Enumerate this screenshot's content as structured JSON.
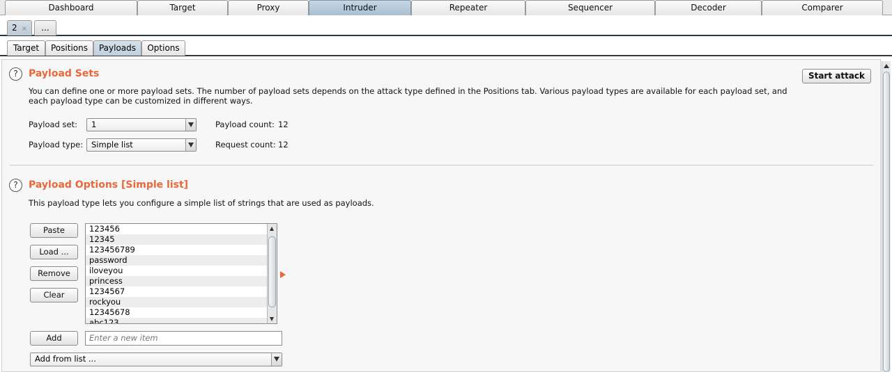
{
  "top_tabs": {
    "dashboard": "Dashboard",
    "target": "Target",
    "proxy": "Proxy",
    "intruder": "Intruder",
    "repeater": "Repeater",
    "sequencer": "Sequencer",
    "decoder": "Decoder",
    "comparer": "Comparer",
    "active": "Intruder"
  },
  "attack_tabs": {
    "current": "2",
    "close": "×",
    "more": "..."
  },
  "intruder_tabs": {
    "target": "Target",
    "positions": "Positions",
    "payloads": "Payloads",
    "options": "Options",
    "active": "Payloads"
  },
  "payload_sets": {
    "title": "Payload Sets",
    "description_line1": "You can define one or more payload sets. The number of payload sets depends on the attack type defined in the Positions tab. Various payload types are available for each payload set, and",
    "description_line2": "each payload type can be customized in different ways.",
    "payload_set_label": "Payload set:",
    "payload_set_value": "1",
    "payload_type_label": "Payload type:",
    "payload_type_value": "Simple list",
    "payload_count_label": "Payload count:",
    "payload_count_value": "12",
    "request_count_label": "Request count:",
    "request_count_value": "12",
    "start_attack": "Start attack"
  },
  "payload_options": {
    "title": "Payload Options [Simple list]",
    "description": "This payload type lets you configure a simple list of strings that are used as payloads.",
    "buttons": {
      "paste": "Paste",
      "load": "Load ...",
      "remove": "Remove",
      "clear": "Clear",
      "add": "Add"
    },
    "list_items": [
      "123456",
      "12345",
      "123456789",
      "password",
      "iloveyou",
      "princess",
      "1234567",
      "rockyou",
      "12345678",
      "abc123"
    ],
    "new_item_placeholder": "Enter a new item",
    "add_from_list": "Add from list ..."
  },
  "colors": {
    "accent": "#e8683a",
    "active_tab": "#b3c6d6"
  }
}
